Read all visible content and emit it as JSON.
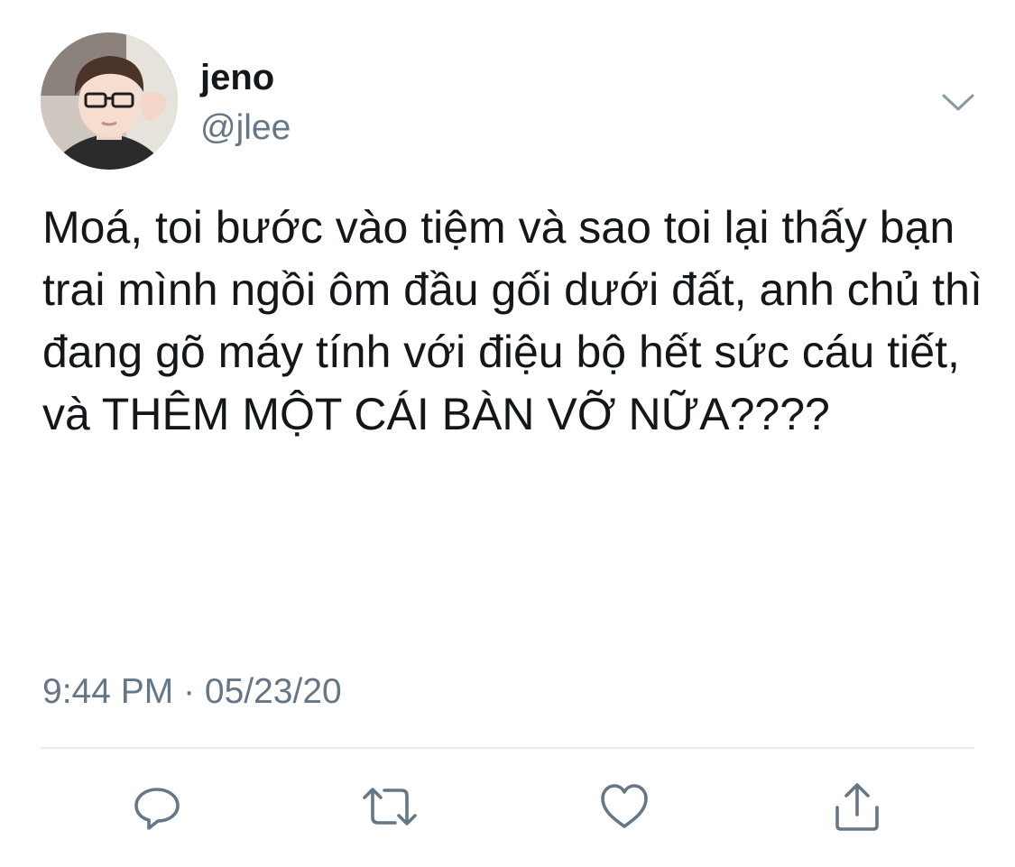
{
  "user": {
    "display_name": "jeno",
    "handle": "@jlee",
    "avatar_icon": "profile-photo"
  },
  "tweet": {
    "text": "Moá, toi bước vào tiệm và sao toi lại thấy bạn trai mình ngồi ôm đầu gối dưới đất, anh chủ thì đang gõ máy tính với điệu bộ hết sức cáu tiết, và THÊM MỘT CÁI BÀN VỠ NỮA????",
    "timestamp": "9:44 PM · 05/23/20"
  },
  "actions": [
    {
      "name": "reply",
      "icon": "speech-bubble-icon"
    },
    {
      "name": "retweet",
      "icon": "retweet-arrows-icon"
    },
    {
      "name": "like",
      "icon": "heart-icon"
    },
    {
      "name": "share",
      "icon": "share-upload-icon"
    }
  ],
  "colors": {
    "text_primary": "#14171a",
    "text_secondary": "#657786",
    "icon": "#657786",
    "divider": "#e6ecf0",
    "background": "#ffffff"
  }
}
